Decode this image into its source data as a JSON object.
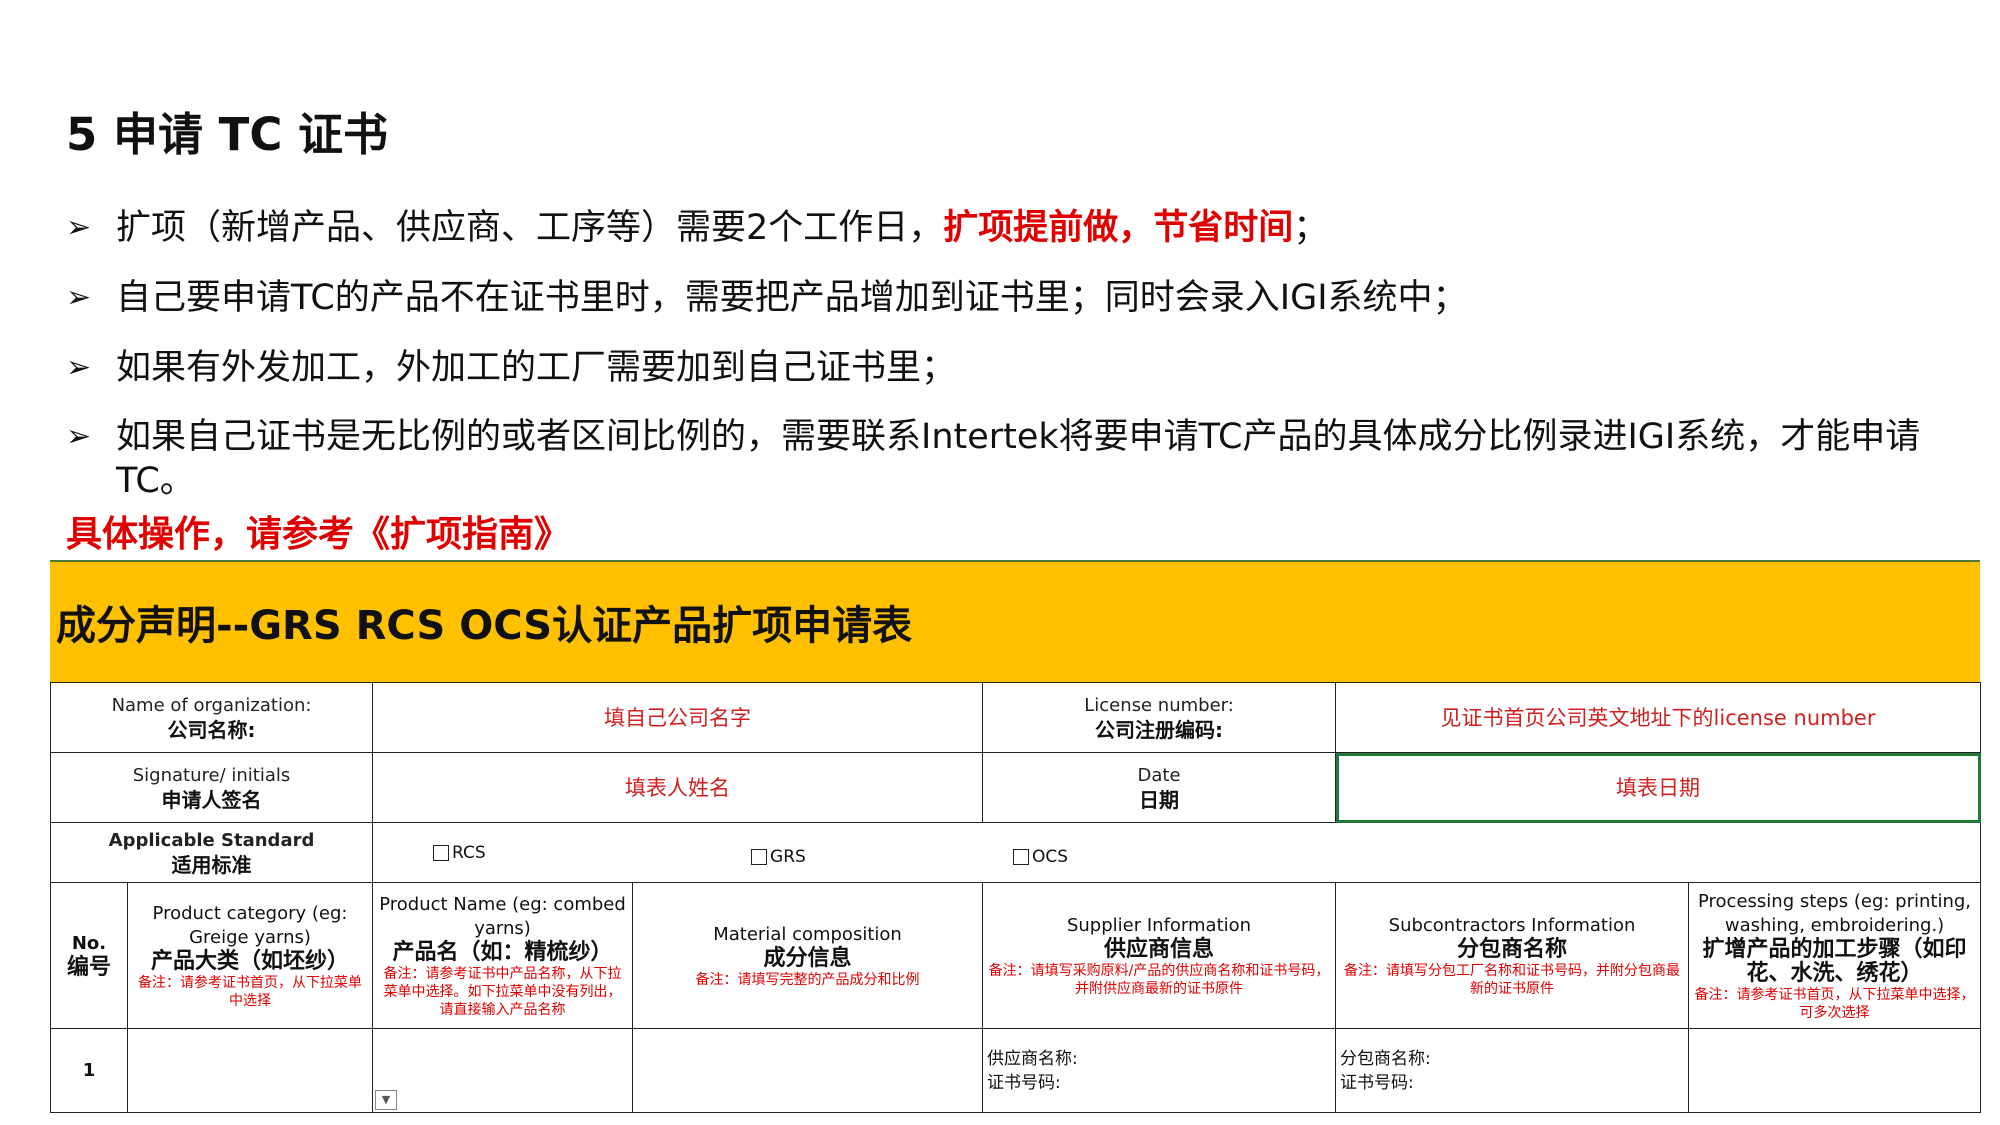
{
  "slide": {
    "title": "5 申请 TC 证书",
    "bullets": [
      {
        "text": "扩项（新增产品、供应商、工序等）需要2个工作日，",
        "highlight": "扩项提前做，节省时间",
        "tail": "；"
      },
      {
        "text": "自己要申请TC的产品不在证书里时，需要把产品增加到证书里；同时会录入IGI系统中；"
      },
      {
        "text": "如果有外发加工，外加工的工厂需要加到自己证书里；"
      },
      {
        "text": "如果自己证书是无比例的或者区间比例的，需要联系Intertek将要申请TC产品的具体成分比例录进IGI系统，才能申请TC。"
      }
    ],
    "bullet_icon": "arrow-bullet-icon",
    "note": "具体操作，请参考《扩项指南》"
  },
  "form": {
    "title": "成分声明--GRS RCS OCS认证产品扩项申请表",
    "org_label_en": "Name of organization:",
    "org_label_cn": "公司名称:",
    "org_value": "填自己公司名字",
    "license_label_en": "License number:",
    "license_label_cn": "公司注册编码:",
    "license_value": "见证书首页公司英文地址下的license number",
    "sign_label_en": "Signature/ initials",
    "sign_label_cn": "申请人签名",
    "sign_value": "填表人姓名",
    "date_label_en": "Date",
    "date_label_cn": "日期",
    "date_value": "填表日期",
    "std_label_en": "Applicable Standard",
    "std_label_cn": "适用标准",
    "standards": [
      "RCS",
      "GRS",
      "OCS"
    ],
    "columns": {
      "no_en": "No.",
      "no_cn": "编号",
      "category_en": "Product category (eg: Greige yarns)",
      "category_cn": "产品大类（如坯纱）",
      "category_hint": "备注：请参考证书首页，从下拉菜单中选择",
      "name_en": "Product Name (eg: combed yarns)",
      "name_cn": "产品名（如：精梳纱）",
      "name_hint": "备注：请参考证书中产品名称，从下拉菜单中选择。如下拉菜单中没有列出，请直接输入产品名称",
      "material_en": "Material composition",
      "material_cn": "成分信息",
      "material_hint": "备注：请填写完整的产品成分和比例",
      "supplier_en": "Supplier Information",
      "supplier_cn": "供应商信息",
      "supplier_hint": "备注：请填写采购原料/产品的供应商名称和证书号码，并附供应商最新的证书原件",
      "sub_en": "Subcontractors  Information",
      "sub_cn": "分包商名称",
      "sub_hint": "备注：请填写分包工厂名称和证书号码，并附分包商最新的证书原件",
      "proc_en": "Processing steps (eg: printing, washing, embroidering.)",
      "proc_cn": "扩增产品的加工步骤（如印花、水洗、绣花）",
      "proc_hint": "备注：请参考证书首页，从下拉菜单中选择，可多次选择"
    },
    "row1": {
      "no": "1",
      "supplier_name": "供应商名称:",
      "supplier_cert": "证书号码:",
      "sub_name": "分包商名称:",
      "sub_cert": "证书号码:"
    }
  }
}
